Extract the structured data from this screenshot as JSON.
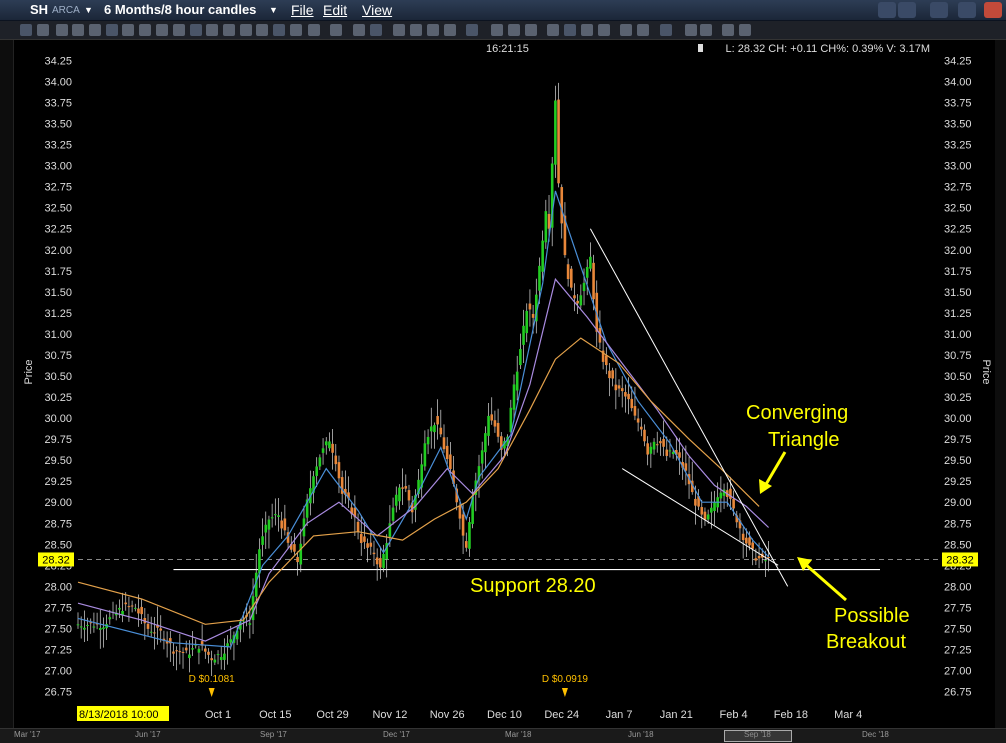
{
  "window": {
    "symbol": "SH",
    "exchange": "ARCA",
    "timeframe": "6 Months/8 hour candles",
    "menus": [
      "File",
      "Edit",
      "View"
    ]
  },
  "chart_header": {
    "clock": "16:21:15",
    "quote": "L: 28.32 CH: +0.11 CH%: 0.39% V: 3.17M"
  },
  "colors": {
    "up": "#22cc22",
    "down": "#e8873a",
    "ema_fast": "#4a8fd8",
    "ema_mid": "#a98be0",
    "ema_slow": "#e3a14a",
    "annotation": "#ffff00",
    "price_tag": "#ffff00"
  },
  "chart_data": {
    "type": "candlestick",
    "ylabel": "Price",
    "ylim": [
      26.75,
      34.25
    ],
    "ytick_step": 0.25,
    "yticks": [
      "34.25",
      "34.00",
      "33.75",
      "33.50",
      "33.25",
      "33.00",
      "32.75",
      "32.50",
      "32.25",
      "32.00",
      "31.75",
      "31.50",
      "31.25",
      "31.00",
      "30.75",
      "30.50",
      "30.25",
      "30.00",
      "29.75",
      "29.50",
      "29.25",
      "29.00",
      "28.75",
      "28.50",
      "28.25",
      "28.00",
      "27.75",
      "27.50",
      "27.25",
      "27.00",
      "26.75"
    ],
    "x_labels": [
      "Oct 1",
      "Oct 15",
      "Oct 29",
      "Nov 12",
      "Nov 26",
      "Dec 10",
      "Dec 24",
      "Jan 7",
      "Jan 21",
      "Feb 4",
      "Feb 18",
      "Mar 4"
    ],
    "x_label_index": [
      44,
      62,
      80,
      98,
      116,
      134,
      152,
      170,
      188,
      206,
      224,
      242
    ],
    "start_date_label": "8/13/2018 10:00",
    "last_price": "28.32",
    "dividends": [
      {
        "label": "D $0.1081",
        "index": 42
      },
      {
        "label": "D $0.0919",
        "index": 153
      }
    ],
    "path": [
      [
        0,
        27.55
      ],
      [
        8,
        27.55
      ],
      [
        14,
        27.75
      ],
      [
        18,
        27.75
      ],
      [
        22,
        27.5
      ],
      [
        26,
        27.45
      ],
      [
        30,
        27.25
      ],
      [
        34,
        27.2
      ],
      [
        38,
        27.3
      ],
      [
        42,
        27.15
      ],
      [
        45,
        27.2
      ],
      [
        48,
        27.35
      ],
      [
        51,
        27.6
      ],
      [
        54,
        27.6
      ],
      [
        57,
        28.45
      ],
      [
        60,
        28.8
      ],
      [
        63,
        28.85
      ],
      [
        66,
        28.5
      ],
      [
        69,
        28.3
      ],
      [
        72,
        29.0
      ],
      [
        74,
        29.35
      ],
      [
        76,
        29.55
      ],
      [
        79,
        29.75
      ],
      [
        81,
        29.5
      ],
      [
        83,
        29.1
      ],
      [
        85,
        29.0
      ],
      [
        87,
        28.8
      ],
      [
        89,
        28.55
      ],
      [
        91,
        28.45
      ],
      [
        93,
        28.4
      ],
      [
        95,
        28.2
      ],
      [
        97,
        28.55
      ],
      [
        99,
        28.9
      ],
      [
        101,
        29.2
      ],
      [
        103,
        29.15
      ],
      [
        105,
        28.9
      ],
      [
        107,
        29.25
      ],
      [
        109,
        29.75
      ],
      [
        112,
        29.95
      ],
      [
        114,
        29.8
      ],
      [
        116,
        29.5
      ],
      [
        118,
        29.2
      ],
      [
        120,
        28.85
      ],
      [
        121,
        28.6
      ],
      [
        122,
        28.5
      ],
      [
        124,
        29.1
      ],
      [
        127,
        29.6
      ],
      [
        129,
        30.05
      ],
      [
        131,
        29.9
      ],
      [
        133,
        29.6
      ],
      [
        135,
        29.8
      ],
      [
        137,
        30.4
      ],
      [
        139,
        30.8
      ],
      [
        141,
        31.3
      ],
      [
        143,
        31.2
      ],
      [
        145,
        31.8
      ],
      [
        147,
        32.5
      ],
      [
        148,
        32.3
      ],
      [
        150,
        33.8
      ],
      [
        151,
        32.8
      ],
      [
        153,
        31.9
      ],
      [
        155,
        31.5
      ],
      [
        157,
        31.4
      ],
      [
        159,
        31.6
      ],
      [
        161,
        31.9
      ],
      [
        162,
        31.45
      ],
      [
        163,
        31.0
      ],
      [
        165,
        30.7
      ],
      [
        167,
        30.5
      ],
      [
        169,
        30.35
      ],
      [
        171,
        30.3
      ],
      [
        173,
        30.2
      ],
      [
        175,
        30.0
      ],
      [
        177,
        29.9
      ],
      [
        179,
        29.6
      ],
      [
        181,
        29.75
      ],
      [
        183,
        29.7
      ],
      [
        185,
        29.55
      ],
      [
        187,
        29.6
      ],
      [
        189,
        29.5
      ],
      [
        191,
        29.35
      ],
      [
        193,
        29.1
      ],
      [
        195,
        28.9
      ],
      [
        197,
        28.75
      ],
      [
        199,
        28.9
      ],
      [
        201,
        29.1
      ],
      [
        203,
        29.2
      ],
      [
        205,
        29.0
      ],
      [
        207,
        28.8
      ],
      [
        209,
        28.6
      ],
      [
        211,
        28.45
      ],
      [
        213,
        28.35
      ],
      [
        215,
        28.3
      ],
      [
        217,
        28.32
      ]
    ],
    "series": [
      {
        "name": "ema_fast",
        "points": [
          [
            0,
            27.62
          ],
          [
            30,
            27.33
          ],
          [
            48,
            27.28
          ],
          [
            58,
            28.25
          ],
          [
            66,
            28.6
          ],
          [
            78,
            29.4
          ],
          [
            88,
            28.9
          ],
          [
            96,
            28.4
          ],
          [
            106,
            29.05
          ],
          [
            114,
            29.65
          ],
          [
            122,
            28.8
          ],
          [
            126,
            29.3
          ],
          [
            136,
            29.8
          ],
          [
            146,
            31.6
          ],
          [
            150,
            32.7
          ],
          [
            158,
            31.8
          ],
          [
            166,
            30.9
          ],
          [
            176,
            30.2
          ],
          [
            186,
            29.7
          ],
          [
            196,
            29.0
          ],
          [
            204,
            29.0
          ],
          [
            212,
            28.55
          ],
          [
            217,
            28.35
          ]
        ]
      },
      {
        "name": "ema_mid",
        "points": [
          [
            0,
            27.8
          ],
          [
            20,
            27.6
          ],
          [
            40,
            27.35
          ],
          [
            54,
            27.6
          ],
          [
            60,
            28.15
          ],
          [
            72,
            28.75
          ],
          [
            82,
            29.0
          ],
          [
            94,
            28.6
          ],
          [
            106,
            28.95
          ],
          [
            116,
            29.4
          ],
          [
            124,
            29.1
          ],
          [
            134,
            29.55
          ],
          [
            142,
            30.4
          ],
          [
            150,
            31.65
          ],
          [
            160,
            31.2
          ],
          [
            172,
            30.6
          ],
          [
            182,
            30.1
          ],
          [
            192,
            29.55
          ],
          [
            200,
            29.2
          ],
          [
            210,
            28.95
          ],
          [
            217,
            28.7
          ]
        ]
      },
      {
        "name": "ema_slow",
        "points": [
          [
            0,
            28.05
          ],
          [
            20,
            27.85
          ],
          [
            40,
            27.55
          ],
          [
            52,
            27.6
          ],
          [
            60,
            28.05
          ],
          [
            74,
            28.6
          ],
          [
            88,
            28.65
          ],
          [
            102,
            28.55
          ],
          [
            112,
            28.8
          ],
          [
            122,
            29.0
          ],
          [
            132,
            29.4
          ],
          [
            142,
            30.1
          ],
          [
            150,
            30.7
          ],
          [
            158,
            30.95
          ],
          [
            170,
            30.65
          ],
          [
            180,
            30.2
          ],
          [
            192,
            29.75
          ],
          [
            202,
            29.4
          ],
          [
            210,
            29.1
          ],
          [
            214,
            28.95
          ]
        ]
      }
    ],
    "support": {
      "value": 28.2,
      "from": 30,
      "to": 252
    },
    "trendlines": [
      {
        "from": [
          161,
          32.25
        ],
        "to": [
          223,
          28.0
        ]
      },
      {
        "from": [
          171,
          29.4
        ],
        "to": [
          220,
          28.25
        ]
      }
    ],
    "annotations": {
      "support_text": "Support 28.20",
      "triangle_line1": "Converging",
      "triangle_line2": "Triangle",
      "breakout_line1": "Possible",
      "breakout_line2": "Breakout"
    }
  },
  "mini_timeline": [
    "Mar '17",
    "Jun '17",
    "Sep '17",
    "Dec '17",
    "Mar '18",
    "Jun '18",
    "Sep '18",
    "Dec '18"
  ]
}
